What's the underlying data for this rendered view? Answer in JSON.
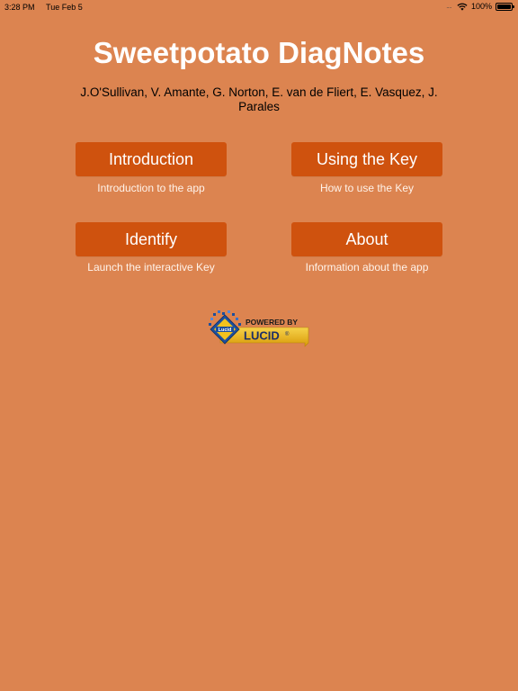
{
  "status_bar": {
    "time": "3:28 PM",
    "date": "Tue Feb 5",
    "signal": "....",
    "battery_text": "100%",
    "battery_level": 1.0
  },
  "app": {
    "title": "Sweetpotato DiagNotes",
    "authors": "J.O'Sullivan, V. Amante, G. Norton, E. van de Fliert, E. Vasquez, J. Parales"
  },
  "menu": {
    "introduction": {
      "label": "Introduction",
      "description": "Introduction to the app"
    },
    "using_key": {
      "label": "Using the Key",
      "description": "How to use the Key"
    },
    "identify": {
      "label": "Identify",
      "description": "Launch the interactive Key"
    },
    "about": {
      "label": "About",
      "description": "Information about the app"
    }
  },
  "badge": {
    "powered_by": "POWERED BY",
    "brand": "LUCID",
    "logo_text": "Lucid",
    "registered": "®"
  },
  "colors": {
    "background": "#dc8450",
    "button": "#cf520e",
    "badge_gold": "#e8b412",
    "badge_blue": "#1d4f9c"
  },
  "icons": [
    "wifi-icon",
    "battery-icon",
    "lucid-logo-icon"
  ]
}
